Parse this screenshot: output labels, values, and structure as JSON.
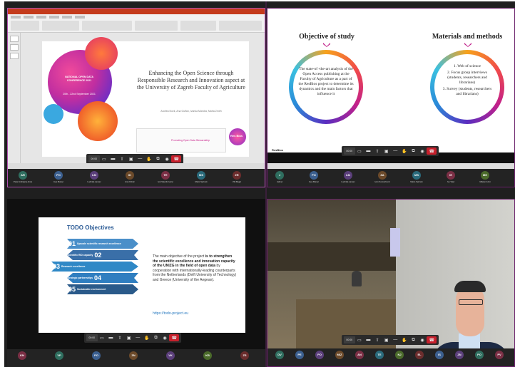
{
  "pane1": {
    "slide": {
      "title": "Enhancing the Open Science through Responsible Research and Innovation aspect at the University of Zagreb Faculty of Agriculture",
      "authors": "Andrea Novk, Ana Gulfan, Ivanka Mandra, Marta Zmirh",
      "conference": "NATIONAL OPEN DATA CONFERENCE 2021",
      "date": "20th - 22nd September 2021",
      "panel_label": "Promoting Open Data Stewardship",
      "logo": "Res Bios"
    },
    "participants": [
      {
        "initials": "AR",
        "name": "Petar Andrijana Ande",
        "color": "#2f6e5f"
      },
      {
        "initials": "PO",
        "name": "Ines Bunac",
        "color": "#3b5f8f"
      },
      {
        "initials": "LM",
        "name": "Ludmila Lamac",
        "color": "#5b3f7b"
      },
      {
        "initials": "IK",
        "name": "Ivan Kirinic",
        "color": "#6c4a2a"
      },
      {
        "initials": "TE",
        "name": "Ivel Vaterlic Ivanc",
        "color": "#7b2f45"
      },
      {
        "initials": "MS",
        "name": "Mario Sprinok",
        "color": "#2a6a7b"
      },
      {
        "initials": "ZR",
        "name": "Vlic Begic",
        "color": "#6b2d2d"
      }
    ]
  },
  "pane2": {
    "left_heading": "Objective of study",
    "left_body": "The state-of -the-art analysis of the Open Access publishing at the Faculty of Agriculture as a part of the ResBios project to determine its dynamics and the main factors that influence it",
    "right_heading": "Materials and methods",
    "methods": [
      "1.   Web of science",
      "2.   Focus group interviews (students, researchers and librarians)",
      "3.   Survey (students, researchers and librarians)"
    ],
    "footer": "ResBios",
    "participants": [
      {
        "initials": "J",
        "name": "Jalmel",
        "color": "#2f6e5f"
      },
      {
        "initials": "PO",
        "name": "Ines Bunac",
        "color": "#3b5f8f"
      },
      {
        "initials": "LM",
        "name": "Ludmila Lamac",
        "color": "#5b3f7b"
      },
      {
        "initials": "ZA",
        "name": "Ivan Konrachovic",
        "color": "#6c4a2a"
      },
      {
        "initials": "MS",
        "name": "Mario Sprinok",
        "color": "#2a6a7b"
      },
      {
        "initials": "IE",
        "name": "Ivo Vlad",
        "color": "#7b2f45"
      },
      {
        "initials": "MH",
        "name": "Mladen Hrst",
        "color": "#4b6b2b"
      }
    ]
  },
  "pane3": {
    "title": "TODO Objectives",
    "bands": [
      {
        "num": "01",
        "label": "Upscale scientific research excellence",
        "color": "#4a8fc9"
      },
      {
        "num": "02",
        "label": "Scientific RID capacity",
        "color": "#3a6fa8"
      },
      {
        "num": "03",
        "label": "Research excellence",
        "color": "#2f88c6"
      },
      {
        "num": "04",
        "label": "Strategic partnerships",
        "color": "#2f7ec0"
      },
      {
        "num": "05",
        "label": "Sustainable environment",
        "color": "#2a5a8a"
      }
    ],
    "body_intro": "The main objective of the project",
    "body_bold1": "is to strengthen the scientific excellence and innovation capacity of the UNIZG in the field of open data",
    "body_rest": "by cooperation with internationally-leading counterparts from the Netherlands (Delft University of Technology) and Greece (University of the Aegean).",
    "link": "https://todo-project.eu",
    "participants": [
      {
        "initials": "KN",
        "name": "",
        "color": "#7b2f45"
      },
      {
        "initials": "VP",
        "name": "",
        "color": "#2f6e5f"
      },
      {
        "initials": "PO",
        "name": "",
        "color": "#3b5f8f"
      },
      {
        "initials": "ZN",
        "name": "",
        "color": "#6c4a2a"
      },
      {
        "initials": "VK",
        "name": "",
        "color": "#5b3f7b"
      },
      {
        "initials": "KB",
        "name": "",
        "color": "#4b6b2b"
      },
      {
        "initials": "ZS",
        "name": "",
        "color": "#6b2d2d"
      }
    ]
  },
  "pane4": {
    "participants": [
      {
        "initials": "DV",
        "color": "#2f6e5f"
      },
      {
        "initials": "PE",
        "color": "#3b5f8f"
      },
      {
        "initials": "PO",
        "color": "#5b3f7b"
      },
      {
        "initials": "MIZ",
        "color": "#6c4a2a"
      },
      {
        "initials": "AN",
        "color": "#7b2f45"
      },
      {
        "initials": "TE",
        "color": "#2a6a7b"
      },
      {
        "initials": "NJ",
        "color": "#4b6b2b"
      },
      {
        "initials": "EL",
        "color": "#6b2d2d"
      },
      {
        "initials": "IS",
        "color": "#3b5f8f"
      },
      {
        "initials": "ZN",
        "color": "#5b3f7b"
      },
      {
        "initials": "PO",
        "color": "#2f6e5f"
      },
      {
        "initials": "PV",
        "color": "#7b2f45"
      }
    ]
  },
  "toolbar": {
    "time": "00:00",
    "icons": [
      "chat-icon",
      "folder-icon",
      "upload-icon",
      "camera-icon",
      "minus-icon",
      "hand-icon",
      "share-icon",
      "record-icon"
    ],
    "end_icon": "end-call-icon"
  }
}
